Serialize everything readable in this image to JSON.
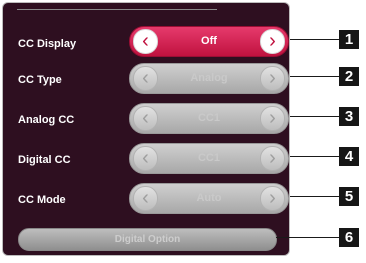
{
  "menu": {
    "rows": [
      {
        "label": "CC Display",
        "value": "Off"
      },
      {
        "label": "CC Type",
        "value": "Analog"
      },
      {
        "label": "Analog CC",
        "value": "CC1"
      },
      {
        "label": "Digital CC",
        "value": "CC1"
      },
      {
        "label": "CC Mode",
        "value": "Auto"
      }
    ],
    "arrow_left": "‹",
    "arrow_right": "›",
    "option_button": "Digital Option"
  },
  "callouts": [
    "1",
    "2",
    "3",
    "4",
    "5",
    "6"
  ],
  "colors": {
    "panel_bg": "#2e0f20",
    "active_accent": "#c0123f",
    "disabled_control": "#b5b5b5"
  }
}
